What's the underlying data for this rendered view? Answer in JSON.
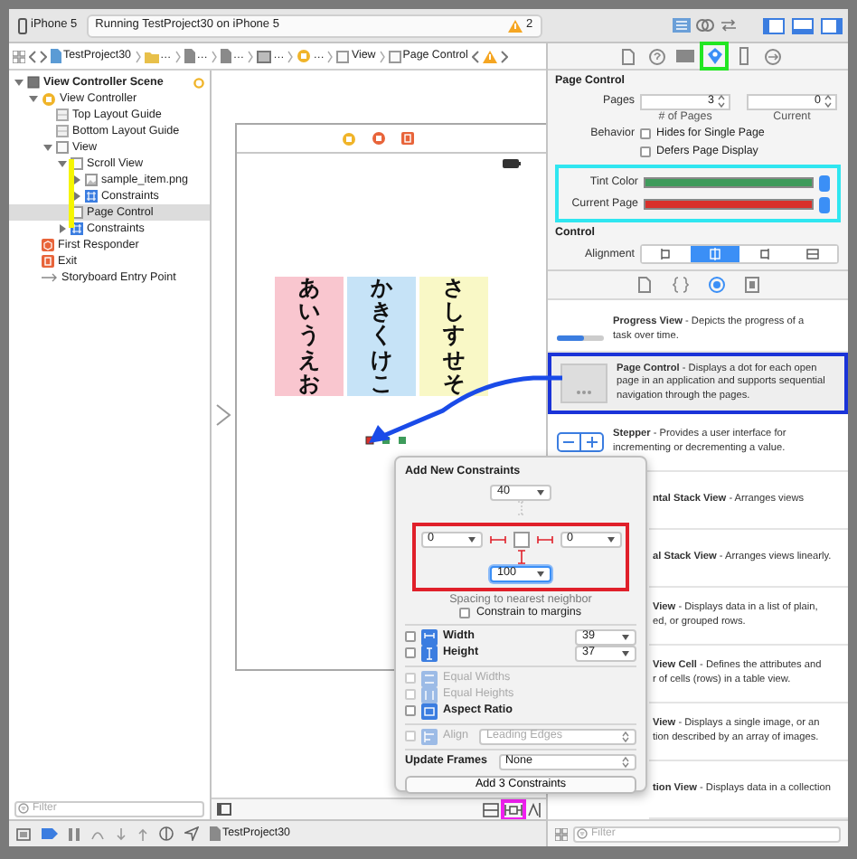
{
  "toolbar": {
    "scheme": "iPhone 5",
    "activity": "Running TestProject30 on iPhone 5",
    "warnings": "2"
  },
  "jump_bar": [
    {
      "kind": "project",
      "label": "TestProject30"
    },
    {
      "kind": "folder",
      "label": "…"
    },
    {
      "kind": "file",
      "label": "…"
    },
    {
      "kind": "file",
      "label": "…"
    },
    {
      "kind": "storyboard",
      "label": "…"
    },
    {
      "kind": "controller",
      "label": "…"
    },
    {
      "kind": "view",
      "label": "View"
    },
    {
      "kind": "view",
      "label": "Page Control"
    }
  ],
  "navigator": {
    "tree": [
      {
        "kind": "scene",
        "label": "View Controller Scene",
        "expanded": true,
        "selected": false,
        "children": [
          {
            "kind": "controller",
            "label": "View Controller",
            "expanded": true,
            "selected": false,
            "children": [
              {
                "kind": "guide",
                "label": "Top Layout Guide",
                "selected": false
              },
              {
                "kind": "guide",
                "label": "Bottom Layout Guide",
                "selected": false
              },
              {
                "kind": "view",
                "label": "View",
                "expanded": true,
                "selected": false,
                "children": [
                  {
                    "kind": "view",
                    "label": "Scroll View",
                    "expanded": true,
                    "selected": false,
                    "children": [
                      {
                        "kind": "image",
                        "label": "sample_item.png",
                        "expanded": false,
                        "selected": false
                      },
                      {
                        "kind": "constraints",
                        "label": "Constraints",
                        "expanded": false,
                        "selected": false
                      }
                    ]
                  },
                  {
                    "kind": "view",
                    "label": "Page Control",
                    "selected": true
                  },
                  {
                    "kind": "constraints",
                    "label": "Constraints",
                    "expanded": false,
                    "selected": false
                  }
                ]
              }
            ]
          },
          {
            "kind": "responder",
            "label": "First Responder",
            "selected": false
          },
          {
            "kind": "exit",
            "label": "Exit",
            "selected": false
          },
          {
            "kind": "entry",
            "label": "Storyboard Entry Point",
            "selected": false
          }
        ]
      }
    ],
    "filter_placeholder": "Filter"
  },
  "canvas": {
    "columns": [
      {
        "text": "あいうえお",
        "color": "#f9c6cf"
      },
      {
        "text": "かきくけこ",
        "color": "#c6e3f7"
      },
      {
        "text": "さしすせそ",
        "color": "#f9f8c6"
      }
    ],
    "dots": [
      {
        "selected": true
      },
      {
        "selected": false
      },
      {
        "selected": false
      }
    ]
  },
  "inspector": {
    "tabs": [
      {
        "kind": "file",
        "selected": false
      },
      {
        "kind": "help",
        "selected": false
      },
      {
        "kind": "identity",
        "selected": false
      },
      {
        "kind": "attributes",
        "selected": true
      },
      {
        "kind": "size",
        "selected": false
      },
      {
        "kind": "connections",
        "selected": false
      }
    ],
    "section": "Page Control",
    "pages_label": "Pages",
    "pages": "3",
    "pages_caption": "# of Pages",
    "current": "0",
    "current_caption": "Current",
    "behavior_label": "Behavior",
    "behavior": [
      {
        "label": "Hides for Single Page",
        "checked": false
      },
      {
        "label": "Defers Page Display",
        "checked": false
      }
    ],
    "colors": [
      {
        "label": "Tint Color",
        "color": "#3e9b5b"
      },
      {
        "label": "Current Page",
        "color": "#d8302a"
      }
    ],
    "control_section": "Control",
    "alignment_label": "Alignment",
    "alignment": [
      {
        "selected": false
      },
      {
        "selected": true
      },
      {
        "selected": false
      },
      {
        "selected": false
      }
    ]
  },
  "library": {
    "tabs": [
      {
        "kind": "file",
        "selected": false
      },
      {
        "kind": "braces",
        "selected": false
      },
      {
        "kind": "object",
        "selected": true
      },
      {
        "kind": "media",
        "selected": false
      }
    ],
    "items": [
      {
        "kind": "progress",
        "highlighted": false,
        "text": "**Progress View** - Depicts the progress of a\ntask over time."
      },
      {
        "kind": "pagecontrol",
        "highlighted": true,
        "text": "**Page Control** - Displays a dot for each open\npage in an application and supports sequential\nnavigation through the pages."
      },
      {
        "kind": "stepper",
        "highlighted": false,
        "text": "**Stepper** - Provides a user interface for\nincrementing or decrementing a value."
      },
      {
        "kind": "covered",
        "highlighted": false,
        "text": "**ntal Stack View** - Arranges views"
      },
      {
        "kind": "covered",
        "highlighted": false,
        "text": "**al Stack View** - Arranges views linearly."
      },
      {
        "kind": "covered",
        "highlighted": false,
        "text": "**View** - Displays data in a list of plain,\ned, or grouped rows."
      },
      {
        "kind": "covered",
        "highlighted": false,
        "text": "**View Cell** - Defines the attributes and\nr of cells (rows) in a table view."
      },
      {
        "kind": "covered",
        "highlighted": false,
        "text": "**View** - Displays a single image, or an\ntion described by an array of images."
      },
      {
        "kind": "covered",
        "highlighted": false,
        "text": "**tion View** - Displays data in a collection"
      }
    ],
    "filter_placeholder": "Filter"
  },
  "popover": {
    "title": "Add New Constraints",
    "spacing": {
      "top": {
        "value": "40",
        "pinned": false,
        "focused": false
      },
      "left": {
        "value": "0",
        "pinned": true,
        "focused": false
      },
      "right": {
        "value": "0",
        "pinned": true,
        "focused": false
      },
      "bottom": {
        "value": "100",
        "pinned": true,
        "focused": true
      }
    },
    "spacing_caption": "Spacing to nearest neighbor",
    "margins": {
      "label": "Constrain to margins",
      "checked": false
    },
    "size": [
      {
        "kind": "width",
        "label": "Width",
        "checked": false,
        "value": "39"
      },
      {
        "kind": "height",
        "label": "Height",
        "checked": false,
        "value": "37"
      }
    ],
    "relations": [
      {
        "kind": "equal-widths",
        "label": "Equal Widths",
        "checked": false,
        "disabled": true
      },
      {
        "kind": "equal-heights",
        "label": "Equal Heights",
        "checked": false,
        "disabled": true
      },
      {
        "kind": "aspect",
        "label": "Aspect Ratio",
        "checked": false,
        "disabled": false
      }
    ],
    "align": {
      "label": "Align",
      "value": "Leading Edges",
      "checked": false,
      "disabled": true
    },
    "update_frames": {
      "label": "Update Frames",
      "value": "None"
    },
    "button": "Add 3 Constraints"
  },
  "debug_bar": {
    "target": "TestProject30"
  }
}
